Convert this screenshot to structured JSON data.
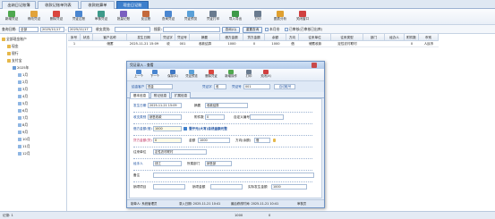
{
  "tabs": [
    "出纳日记账簿",
    "收款记账单列表",
    "收款结算单",
    "现金日记账"
  ],
  "toolbar": [
    "新增凭证",
    "修改凭证",
    "删除凭证",
    "凭证过账",
    "审核凭证",
    "批量记账",
    "反过账",
    "查询凭证",
    "凭证预览",
    "凭证打印",
    "导入导出",
    "打印",
    "图表分析",
    "关闭窗口"
  ],
  "filter": {
    "label_query": "查询日期:",
    "range_value": "全部",
    "date_from": "2025/11/17",
    "date_to": "2025/11/17",
    "label_voucher": "收支类别:",
    "label_search": "搜索:",
    "btn_query": "查询(Q)",
    "btn_reset": "重置查询",
    "chk_month": "本月份",
    "chk_audit": "已审核(已审核已出库)"
  },
  "tree": {
    "root": "全部现金账户",
    "nodes": [
      "现金",
      "银行",
      "支付宝"
    ],
    "year": "2025年",
    "months": [
      "1月",
      "2月",
      "3月",
      "4月",
      "5月",
      "6月",
      "7月",
      "8月",
      "9月",
      "10月",
      "11月",
      "12月"
    ]
  },
  "grid": {
    "headers": [
      "序号",
      "状态",
      "客户名称",
      "发生日期",
      "凭证字",
      "凭证号",
      "摘要",
      "借方金额",
      "贷方金额",
      "余额",
      "方向",
      "往来单位",
      "往来类型",
      "部门",
      "经办人",
      "附件数",
      "币别"
    ],
    "row": [
      "1",
      "",
      "储蓄",
      "2025-11-21 15:09",
      "收",
      "001",
      "收款结算",
      "1000",
      "0",
      "1000",
      "借",
      "储蓄收款",
      "定性农村联村",
      "",
      "",
      "0",
      "人民币"
    ]
  },
  "status": {
    "left": "记录: 1",
    "mid": "1000",
    "right": "0"
  },
  "dialog": {
    "title": "凭证录入 - 查看",
    "toolbar": [
      "上一个",
      "下一个",
      "保存(S)",
      "凭证预览",
      "删除凭证",
      "新增操作",
      "打印",
      "关闭(X)"
    ],
    "sub_label_customer": "结金客户",
    "sub_customer": "现金",
    "sub_label_voucher": "凭证字",
    "sub_voucher": "收",
    "sub_label_no": "凭证号",
    "sub_no": "001",
    "sub_btn": "自动取号",
    "tabs": [
      "基本信息",
      "附记信息",
      "扩展信息"
    ],
    "fields": {
      "l_date": "发生日期",
      "v_date": "2025-11-21 15:09",
      "l_summary": "摘要",
      "v_summary": "收款结算",
      "l_type": "收支类别",
      "v_type": "销售收款",
      "l_attach": "附件数",
      "v_attach": "0",
      "l_ref": "自定义编号",
      "v_ref": "",
      "l_debit": "借方金额(借)",
      "v_debit": "1000",
      "cap": "壹仟元(大写)自然金额元整",
      "l_credit": "贷方金额(贷)",
      "v_credit": "0",
      "l_amount": "金额",
      "v_amount": "1000",
      "l_dir": "方向(余额)",
      "v_dir": "借",
      "l_unit": "往来单位",
      "v_unit": "定性农村联村",
      "l_handler": "经手人",
      "v_handler": "钱江",
      "l_dept": "所属部门",
      "v_dept": "销售部",
      "l_remark": "备注",
      "v_remark": "",
      "l_proj": "销项项目",
      "v_proj": "",
      "l_amt2": "销项金额",
      "v_amt2": "",
      "l_real": "实际发生金额",
      "v_real": "1000"
    },
    "footer": {
      "maker": "制单人: 系统管理员",
      "make_time": "录入日期: 2025-11-21 10:41",
      "modify": "最后修改时间: 2025-11-21 10:41",
      "auditor": "审核员"
    }
  },
  "colors": {
    "accent": "#3d7fcc",
    "required": "#fffbe6"
  }
}
